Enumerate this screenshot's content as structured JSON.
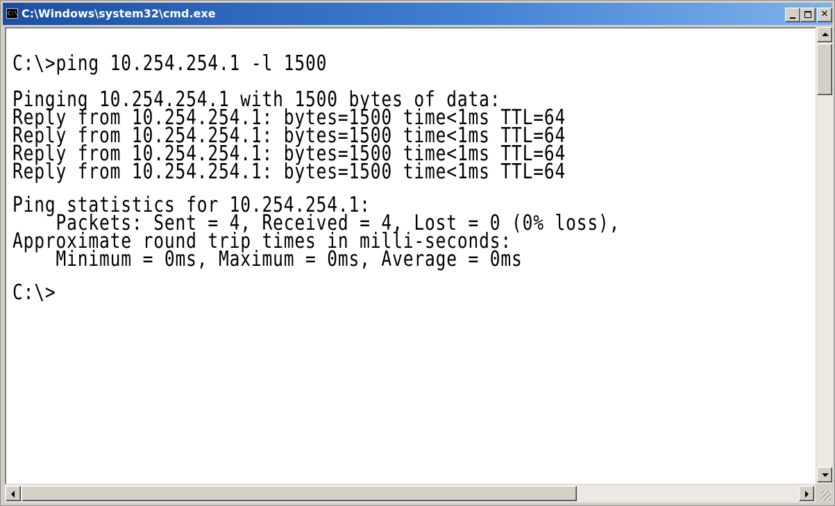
{
  "window": {
    "title": "C:\\Windows\\system32\\cmd.exe",
    "icon_label": "C:\\",
    "icon": "cmd-icon",
    "controls": [
      "minimize-icon",
      "maximize-icon",
      "close-icon"
    ],
    "close_glyph": "✕"
  },
  "console": {
    "command_line": "C:\\>ping 10.254.254.1 -l 1500",
    "pinging_line": "Pinging 10.254.254.1 with 1500 bytes of data:",
    "replies": [
      "Reply from 10.254.254.1: bytes=1500 time<1ms TTL=64",
      "Reply from 10.254.254.1: bytes=1500 time<1ms TTL=64",
      "Reply from 10.254.254.1: bytes=1500 time<1ms TTL=64",
      "Reply from 10.254.254.1: bytes=1500 time<1ms TTL=64"
    ],
    "stats_header": "Ping statistics for 10.254.254.1:",
    "packets_line": "    Packets: Sent = 4, Received = 4, Lost = 0 (0% loss),",
    "rtt_header": "Approximate round trip times in milli-seconds:",
    "rtt_line": "    Minimum = 0ms, Maximum = 0ms, Average = 0ms",
    "prompt": "C:\\>"
  },
  "colors": {
    "console_bg": "#ffffff",
    "console_fg": "#000000",
    "titlebar_start": "#1b4fa3",
    "titlebar_end": "#7fb2ec"
  }
}
